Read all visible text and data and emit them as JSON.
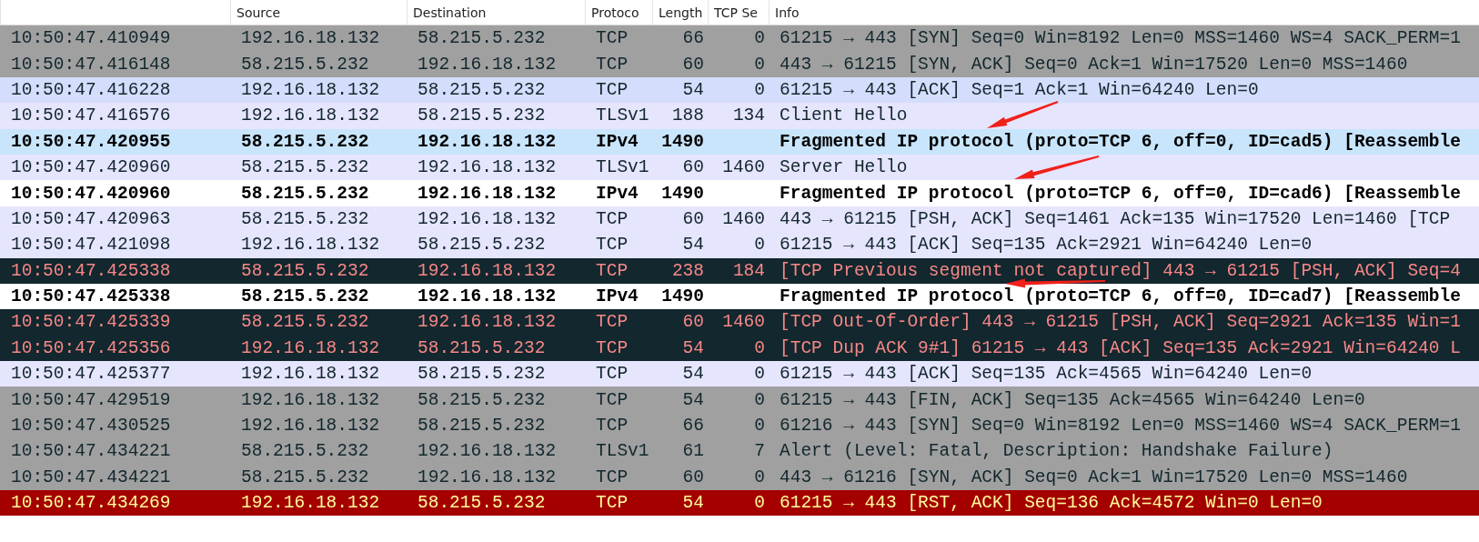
{
  "packet_list": {
    "columns": [
      "",
      "Source",
      "Destination",
      "Protoco",
      "Length",
      "TCP Se",
      "Info"
    ],
    "rows": [
      {
        "cells": [
          "10:50:47.410949",
          "192.16.18.132",
          "58.215.5.232",
          "TCP",
          "66",
          "0",
          "61215 → 443 [SYN] Seq=0 Win=8192 Len=0 MSS=1460 WS=4 SACK_PERM=1"
        ],
        "color": "#a0a0a0",
        "kind": "normal"
      },
      {
        "cells": [
          "10:50:47.416148",
          "58.215.5.232",
          "192.16.18.132",
          "TCP",
          "60",
          "0",
          "443 → 61215 [SYN, ACK] Seq=0 Ack=1 Win=17520 Len=0 MSS=1460"
        ],
        "color": "#a0a0a0",
        "kind": "normal"
      },
      {
        "cells": [
          "10:50:47.416228",
          "192.16.18.132",
          "58.215.5.232",
          "TCP",
          "54",
          "0",
          "61215 → 443 [ACK] Seq=1 Ack=1 Win=64240 Len=0"
        ],
        "color": "#d4defc",
        "kind": "normal"
      },
      {
        "cells": [
          "10:50:47.416576",
          "192.16.18.132",
          "58.215.5.232",
          "TLSv1",
          "188",
          "134",
          "Client Hello"
        ],
        "color": "#e6e5fe",
        "kind": "normal"
      },
      {
        "cells": [
          "10:50:47.420955",
          "58.215.5.232",
          "192.16.18.132",
          "IPv4",
          "1490",
          "",
          "Fragmented IP protocol (proto=TCP 6, off=0, ID=cad5) [Reassemble"
        ],
        "color": "#c8e5fc",
        "kind": "fragment"
      },
      {
        "cells": [
          "10:50:47.420960",
          "58.215.5.232",
          "192.16.18.132",
          "TLSv1",
          "60",
          "1460",
          "Server Hello"
        ],
        "color": "#e6e5fe",
        "kind": "normal"
      },
      {
        "cells": [
          "10:50:47.420960",
          "58.215.5.232",
          "192.16.18.132",
          "IPv4",
          "1490",
          "",
          "Fragmented IP protocol (proto=TCP 6, off=0, ID=cad6) [Reassemble"
        ],
        "color": "#ffffff",
        "kind": "fragment"
      },
      {
        "cells": [
          "10:50:47.420963",
          "58.215.5.232",
          "192.16.18.132",
          "TCP",
          "60",
          "1460",
          "443 → 61215 [PSH, ACK] Seq=1461 Ack=135 Win=17520 Len=1460 [TCP"
        ],
        "color": "#e6e5fe",
        "kind": "normal"
      },
      {
        "cells": [
          "10:50:47.421098",
          "192.16.18.132",
          "58.215.5.232",
          "TCP",
          "54",
          "0",
          "61215 → 443 [ACK] Seq=135 Ack=2921 Win=64240 Len=0"
        ],
        "color": "#e6e5fe",
        "kind": "normal"
      },
      {
        "cells": [
          "10:50:47.425338",
          "58.215.5.232",
          "192.16.18.132",
          "TCP",
          "238",
          "184",
          "[TCP Previous segment not captured] 443 → 61215 [PSH, ACK] Seq=4"
        ],
        "color": "#12272e",
        "kind": "error"
      },
      {
        "cells": [
          "10:50:47.425338",
          "58.215.5.232",
          "192.16.18.132",
          "IPv4",
          "1490",
          "",
          "Fragmented IP protocol (proto=TCP 6, off=0, ID=cad7) [Reassemble"
        ],
        "color": "#ffffff",
        "kind": "fragment"
      },
      {
        "cells": [
          "10:50:47.425339",
          "58.215.5.232",
          "192.16.18.132",
          "TCP",
          "60",
          "1460",
          "[TCP Out-Of-Order] 443 → 61215 [PSH, ACK] Seq=2921 Ack=135 Win=1"
        ],
        "color": "#12272e",
        "kind": "error"
      },
      {
        "cells": [
          "10:50:47.425356",
          "192.16.18.132",
          "58.215.5.232",
          "TCP",
          "54",
          "0",
          "[TCP Dup ACK 9#1] 61215 → 443 [ACK] Seq=135 Ack=2921 Win=64240 L"
        ],
        "color": "#12272e",
        "kind": "error"
      },
      {
        "cells": [
          "10:50:47.425377",
          "192.16.18.132",
          "58.215.5.232",
          "TCP",
          "54",
          "0",
          "61215 → 443 [ACK] Seq=135 Ack=4565 Win=64240 Len=0"
        ],
        "color": "#e6e5fe",
        "kind": "normal"
      },
      {
        "cells": [
          "10:50:47.429519",
          "192.16.18.132",
          "58.215.5.232",
          "TCP",
          "54",
          "0",
          "61215 → 443 [FIN, ACK] Seq=135 Ack=4565 Win=64240 Len=0"
        ],
        "color": "#a0a0a0",
        "kind": "normal"
      },
      {
        "cells": [
          "10:50:47.430525",
          "192.16.18.132",
          "58.215.5.232",
          "TCP",
          "66",
          "0",
          "61216 → 443 [SYN] Seq=0 Win=8192 Len=0 MSS=1460 WS=4 SACK_PERM=1"
        ],
        "color": "#a0a0a0",
        "kind": "normal"
      },
      {
        "cells": [
          "10:50:47.434221",
          "58.215.5.232",
          "192.16.18.132",
          "TLSv1",
          "61",
          "7",
          "Alert (Level: Fatal, Description: Handshake Failure)"
        ],
        "color": "#a0a0a0",
        "kind": "normal"
      },
      {
        "cells": [
          "10:50:47.434221",
          "58.215.5.232",
          "192.16.18.132",
          "TCP",
          "60",
          "0",
          "443 → 61216 [SYN, ACK] Seq=0 Ack=1 Win=17520 Len=0 MSS=1460"
        ],
        "color": "#a0a0a0",
        "kind": "normal"
      },
      {
        "cells": [
          "10:50:47.434269",
          "192.16.18.132",
          "58.215.5.232",
          "TCP",
          "54",
          "0",
          "61215 → 443 [RST, ACK] Seq=136 Ack=4572 Win=0 Len=0"
        ],
        "color": "#a40000",
        "kind": "reset"
      }
    ]
  }
}
